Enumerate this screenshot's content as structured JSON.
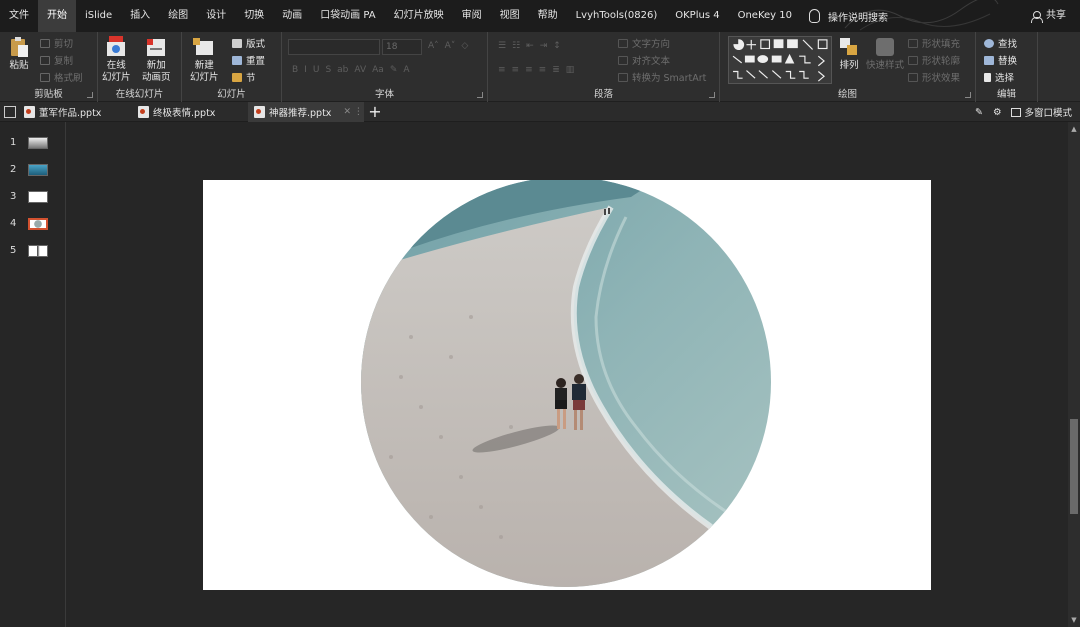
{
  "menu": {
    "items": [
      "文件",
      "开始",
      "iSlide",
      "插入",
      "绘图",
      "设计",
      "切换",
      "动画",
      "口袋动画 PA",
      "幻灯片放映",
      "审阅",
      "视图",
      "帮助",
      "LvyhTools(0826)",
      "OKPlus 4",
      "OneKey 10"
    ],
    "active_index": 1,
    "search_label": "操作说明搜索",
    "share_label": "共享"
  },
  "ribbon": {
    "clipboard": {
      "paste": "粘贴",
      "cut": "剪切",
      "copy": "复制",
      "format_painter": "格式刷",
      "label": "剪贴板"
    },
    "online_slides": {
      "online_slide": "在线\n幻灯片",
      "new_anim_page": "新加\n动画页",
      "hot_badge": "HOT",
      "label": "在线幻灯片"
    },
    "slides": {
      "new_slide": "新建\n幻灯片",
      "layout": "版式",
      "reset": "重置",
      "section": "节",
      "label": "幻灯片"
    },
    "font": {
      "size": "18",
      "label": "字体"
    },
    "paragraph": {
      "text_direction": "文字方向",
      "align_text": "对齐文本",
      "convert_smartart": "转换为 SmartArt",
      "label": "段落"
    },
    "drawing": {
      "arrange": "排列",
      "quick_styles": "快速样式",
      "shape_fill": "形状填充",
      "shape_outline": "形状轮廓",
      "shape_effects": "形状效果",
      "label": "绘图"
    },
    "editing": {
      "find": "查找",
      "replace": "替换",
      "select": "选择",
      "label": "编辑"
    }
  },
  "tabs": [
    {
      "name": "董军作品.pptx",
      "active": false
    },
    {
      "name": "终极表情.pptx",
      "active": false
    },
    {
      "name": "神器推荐.pptx",
      "active": true
    }
  ],
  "tabbar_right": {
    "multi_window": "多窗口模式"
  },
  "thumbnails": [
    {
      "num": "1",
      "selected": false
    },
    {
      "num": "2",
      "selected": false
    },
    {
      "num": "3",
      "selected": false
    },
    {
      "num": "4",
      "selected": true
    },
    {
      "num": "5",
      "selected": false
    }
  ],
  "colors": {
    "accent": "#d35230",
    "menubar": "#1c1c1c",
    "ribbon": "#2e2e2e",
    "slide_bg": "#ffffff"
  }
}
